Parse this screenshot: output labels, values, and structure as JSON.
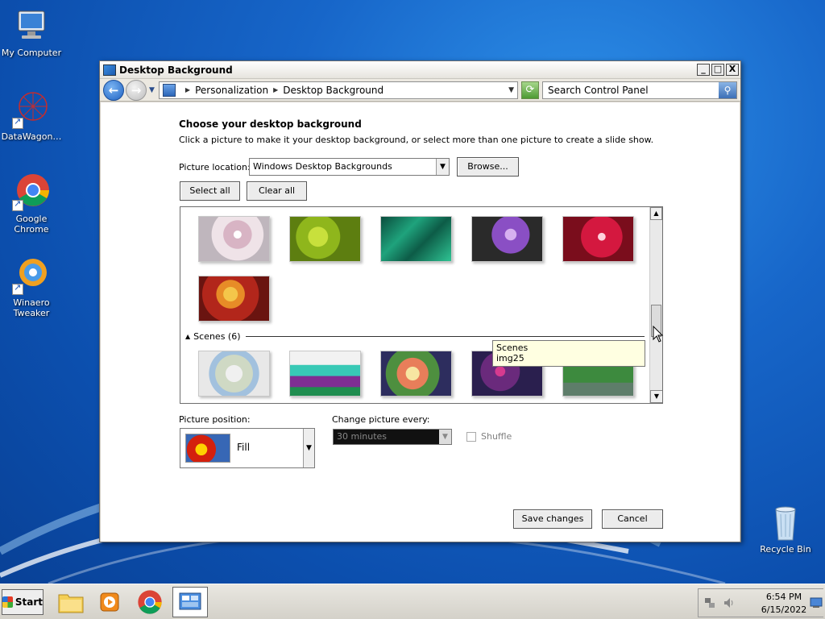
{
  "desktop": {
    "icons": [
      {
        "label": "My Computer",
        "icon": "computer-icon"
      },
      {
        "label": "DataWagon…",
        "icon": "datawagon-icon"
      },
      {
        "label": "Google Chrome",
        "icon": "chrome-icon"
      },
      {
        "label": "Winaero Tweaker",
        "icon": "winaero-icon"
      },
      {
        "label": "Recycle Bin",
        "icon": "recycle-bin-icon"
      }
    ]
  },
  "window": {
    "title": "Desktop Background",
    "controls": {
      "minimize": "_",
      "maximize": "□",
      "close": "X"
    },
    "breadcrumb": [
      "Personalization",
      "Desktop Background"
    ],
    "search_placeholder": "Search Control Panel"
  },
  "content": {
    "heading": "Choose your desktop background",
    "subtitle": "Click a picture to make it your desktop background, or select more than one picture to create a slide show.",
    "picture_location_label": "Picture location:",
    "picture_location_value": "Windows Desktop Backgrounds",
    "browse_label": "Browse...",
    "select_all_label": "Select all",
    "clear_all_label": "Clear all",
    "group_label": "Scenes (6)",
    "tooltip": {
      "line1": "Scenes",
      "line2": "img25"
    },
    "picture_position_label": "Picture position:",
    "picture_position_value": "Fill",
    "change_picture_label": "Change picture every:",
    "change_picture_value": "30 minutes",
    "shuffle_label": "Shuffle",
    "save_label": "Save changes",
    "cancel_label": "Cancel"
  },
  "taskbar": {
    "start_label": "Start",
    "time": "6:54 PM",
    "date": "6/15/2022"
  }
}
